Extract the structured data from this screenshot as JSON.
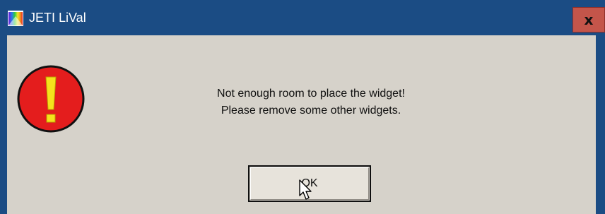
{
  "window": {
    "title": "JETI LiVal",
    "close_label": "x",
    "app_icon": "jeti-rainbow-app-icon",
    "close_icon": "close-icon"
  },
  "dialog": {
    "icon": "exclamation-warning-icon",
    "message_line1": "Not enough room to place the widget!",
    "message_line2": "Please remove some other widgets.",
    "ok_label": "OK"
  },
  "colors": {
    "titlebar": "#1b4c84",
    "client_background": "#d6d2ca",
    "close_button": "#c4554a",
    "warning_red": "#e41d1d",
    "warning_yellow": "#f5e21c"
  },
  "cursor": "arrow-pointer-icon"
}
